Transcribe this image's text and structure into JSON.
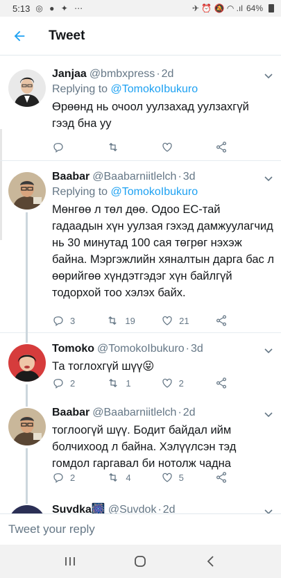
{
  "status_bar": {
    "time": "5:13",
    "battery": "64%"
  },
  "header": {
    "title": "Tweet"
  },
  "tweets": [
    {
      "name": "Janjaa",
      "handle": "@bmbxpress",
      "time": "2d",
      "replying_label": "Replying to",
      "replying_to": "@TomokoIbukuro",
      "text": "Өрөөнд нь очоол уулзахад уулзахгүй гээд бна уу",
      "replies": "",
      "retweets": "",
      "likes": ""
    },
    {
      "name": "Baabar",
      "handle": "@Baabarniitlelch",
      "time": "3d",
      "replying_label": "Replying to",
      "replying_to": "@TomokoIbukuro",
      "text": "Мөнгөө л төл дөө. Одоо ЕС-тай гадаадын хүн уулзая гэхэд дамжуулагчид нь 30 минутад 100 сая төгрөг нэхэж байна. Мэргэжлийн хяналтын дарга бас л өөрийгөө хүндэтгэдэг хүн байлгүй тодорхой тоо хэлэх байх.",
      "replies": "3",
      "retweets": "19",
      "likes": "21"
    },
    {
      "name": "Tomoko",
      "handle": "@TomokoIbukuro",
      "time": "3d",
      "text": "Та тоглохгүй шүү😝",
      "replies": "2",
      "retweets": "1",
      "likes": "2"
    },
    {
      "name": "Baabar",
      "handle": "@Baabarniitlelch",
      "time": "2d",
      "text": "тоглоогүй шүү. Бодит байдал ийм болчихоод л байна. Хэлүүлсэн тэд гомдол гаргавал би нотолж чадна",
      "replies": "2",
      "retweets": "4",
      "likes": "5"
    },
    {
      "name": "Suvdka🎆",
      "handle": "@Suvdok",
      "time": "2d"
    }
  ],
  "reply_bar": {
    "placeholder": "Tweet your reply"
  },
  "colors": {
    "accent": "#1da1f2",
    "secondary_text": "#657786",
    "like": "#e0245e"
  }
}
